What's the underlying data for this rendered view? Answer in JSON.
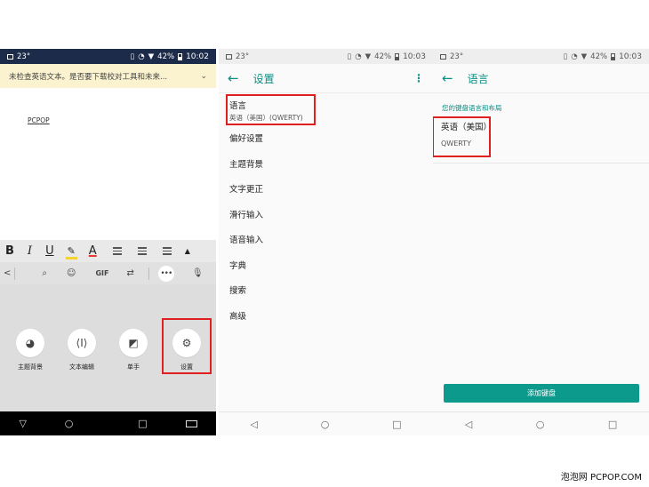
{
  "panel1": {
    "status": {
      "temp": "23°",
      "battery": "42%",
      "time": "10:02"
    },
    "notice": "未检查英语文本。是否要下载校对工具和未来...",
    "doc_text": "PCPOP",
    "format_bar": {
      "bold": "B",
      "italic": "I",
      "underline": "U",
      "highlight": "✎",
      "font_color": "A",
      "collapse": "▲"
    },
    "keyboard_top": {
      "back": "<",
      "gif": "GIF",
      "more": "•••"
    },
    "tiles": [
      {
        "label": "主题背景",
        "icon": "palette-icon"
      },
      {
        "label": "文本编辑",
        "icon": "cursor-icon"
      },
      {
        "label": "单手",
        "icon": "one-hand-icon"
      },
      {
        "label": "设置",
        "icon": "gear-icon"
      }
    ]
  },
  "panel2": {
    "status": {
      "temp": "23°",
      "battery": "42%",
      "time": "10:03"
    },
    "title": "设置",
    "items": [
      {
        "label": "语言",
        "sub": "英语（美国）(QWERTY)"
      },
      {
        "label": "偏好设置"
      },
      {
        "label": "主题背景"
      },
      {
        "label": "文字更正"
      },
      {
        "label": "滑行输入"
      },
      {
        "label": "语音输入"
      },
      {
        "label": "字典"
      },
      {
        "label": "搜索"
      },
      {
        "label": "高级"
      }
    ]
  },
  "panel3": {
    "status": {
      "temp": "23°",
      "battery": "42%",
      "time": "10:03"
    },
    "title": "语言",
    "subheader": "您的键盘语言和布局",
    "language": "英语（美国）",
    "layout": "QWERTY",
    "add_button": "添加键盘"
  },
  "watermark": "泡泡网 PCPOP.COM",
  "colors": {
    "accent": "#0a8f84",
    "highlight_box": "#e02020",
    "status_dark": "#1d2b4a",
    "notice_bg": "#fbf3d0"
  }
}
